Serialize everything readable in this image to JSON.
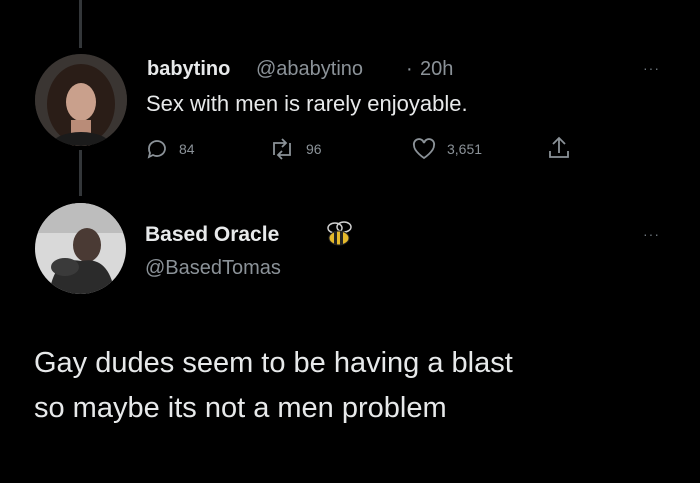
{
  "tweet1": {
    "display_name": "babytino",
    "handle": "@ababytino",
    "separator": "·",
    "time": "20h",
    "text": "Sex with men is rarely enjoyable.",
    "actions": {
      "replies": "84",
      "retweets": "96",
      "likes": "3,651"
    },
    "more": "···"
  },
  "tweet2": {
    "display_name": "Based Oracle",
    "badge_icon": "bee-icon",
    "handle": "@BasedTomas",
    "text_line1": "Gay dudes seem to be having a blast",
    "text_line2": "so maybe its not a men problem",
    "more": "···"
  },
  "colors": {
    "background": "#000000",
    "text": "#e7e9ea",
    "muted": "#8b9298",
    "thread_line": "#333639"
  }
}
